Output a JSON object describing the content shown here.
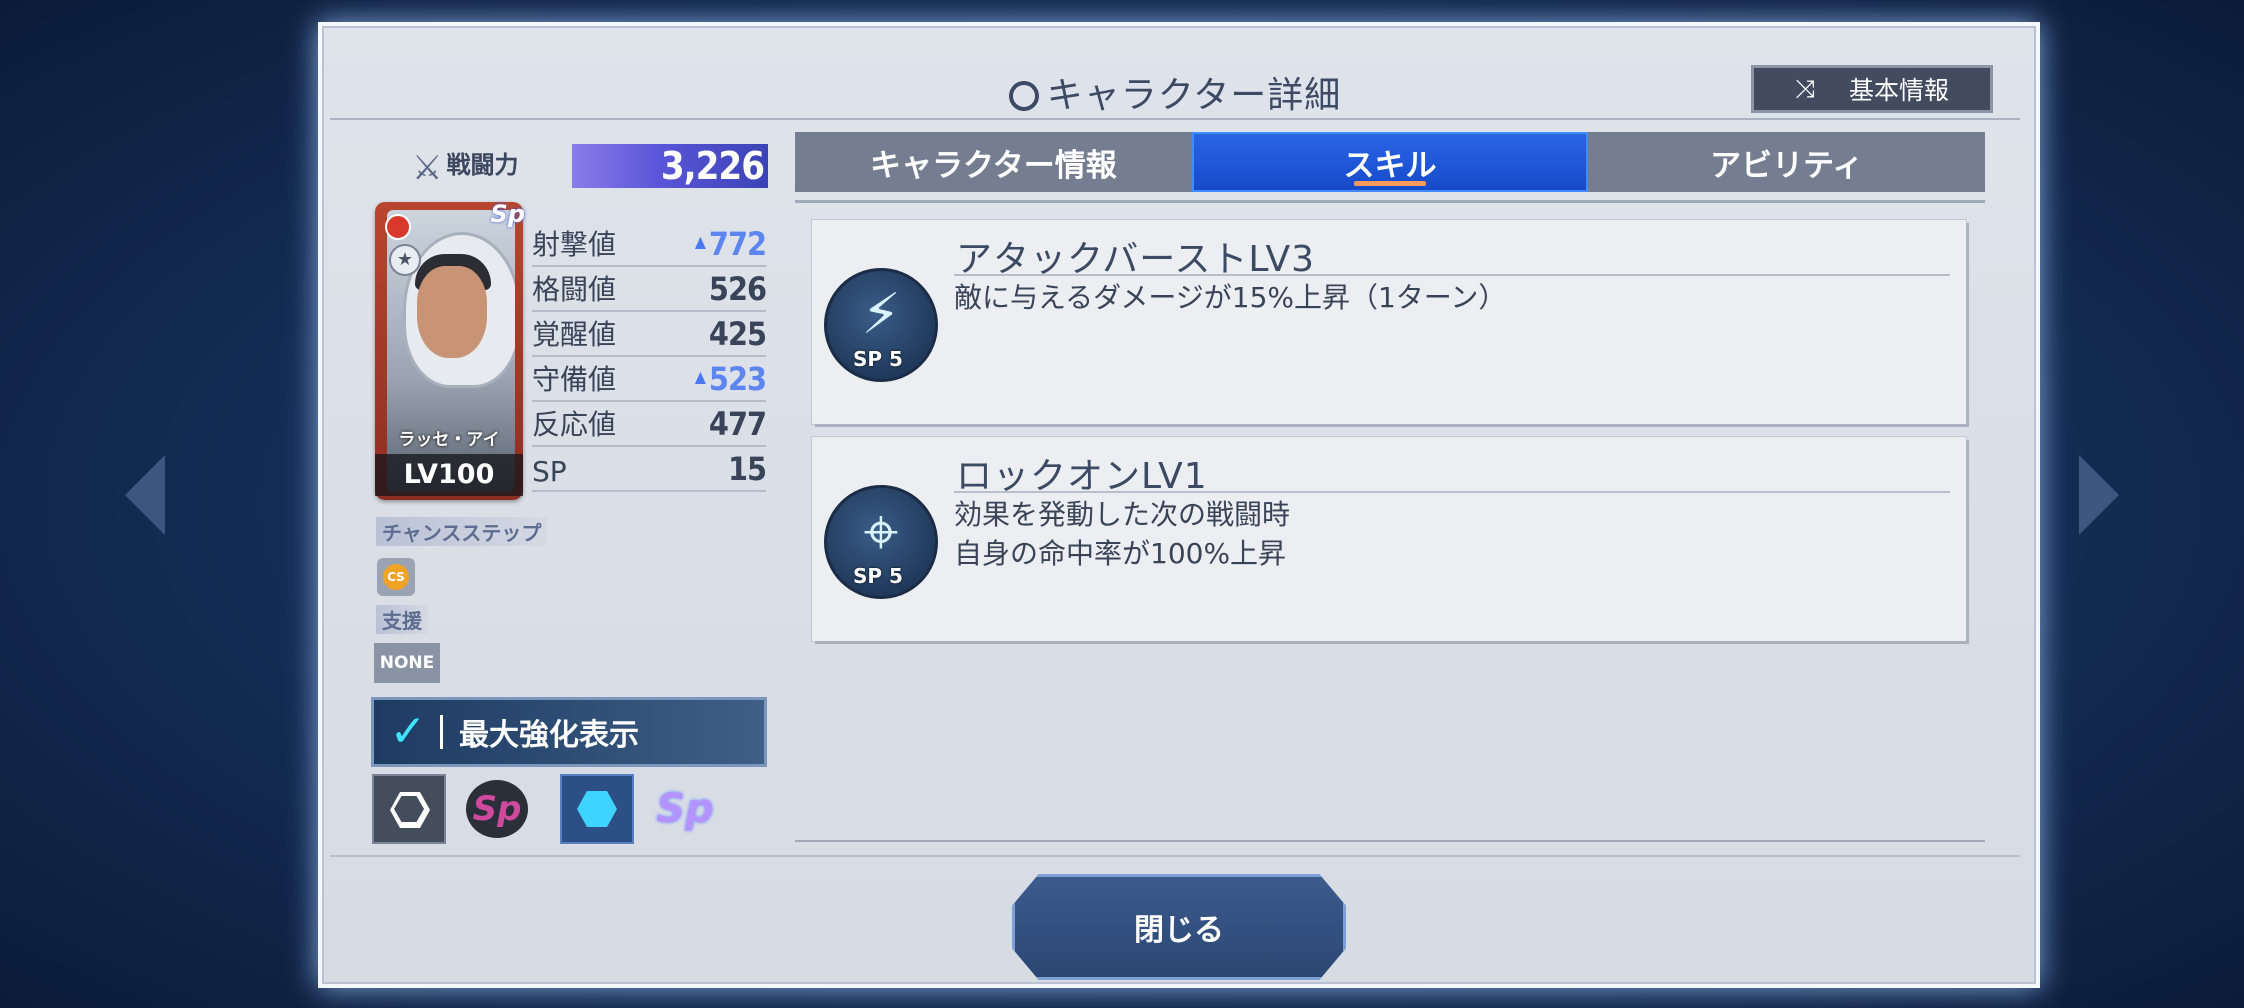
{
  "header": {
    "title": "キャラクター詳細",
    "basic_info_button": "基本情報"
  },
  "power": {
    "label": "戦闘力",
    "value": "3,226"
  },
  "character": {
    "name": "ラッセ・アイ",
    "level": "LV100",
    "badge": "Sp"
  },
  "stats": [
    {
      "label": "射撃値",
      "value": "772",
      "boosted": true
    },
    {
      "label": "格闘値",
      "value": "526",
      "boosted": false
    },
    {
      "label": "覚醒値",
      "value": "425",
      "boosted": false
    },
    {
      "label": "守備値",
      "value": "523",
      "boosted": true
    },
    {
      "label": "反応値",
      "value": "477",
      "boosted": false
    },
    {
      "label": "SP",
      "value": "15",
      "boosted": false
    }
  ],
  "chance_step": {
    "label": "チャンスステップ",
    "coin": "CS"
  },
  "support": {
    "label": "支援",
    "value": "NONE"
  },
  "max_enhance": {
    "label": "最大強化表示",
    "checked": true
  },
  "mode_icons": [
    "hexagon-outline-icon",
    "sp-dark-icon",
    "hexagon-filled-icon",
    "sp-color-icon"
  ],
  "mode_sp_label": "Sp",
  "tabs": [
    {
      "label": "キャラクター情報",
      "active": false
    },
    {
      "label": "スキル",
      "active": true
    },
    {
      "label": "アビリティ",
      "active": false
    }
  ],
  "skills": [
    {
      "name": "アタックバーストLV3",
      "description": "敵に与えるダメージが15%上昇（1ターン）",
      "cost": "SP 5",
      "icon": "lightning-icon"
    },
    {
      "name": "ロックオンLV1",
      "description": "効果を発動した次の戦闘時\n自身の命中率が100%上昇",
      "cost": "SP 5",
      "icon": "crosshair-icon"
    }
  ],
  "close_button": "閉じる",
  "colors": {
    "active_tab": "#1f58d8",
    "boost_stat": "#5d85f0",
    "power_bar": "#5a55d8",
    "card_frame": "#b8452f"
  }
}
